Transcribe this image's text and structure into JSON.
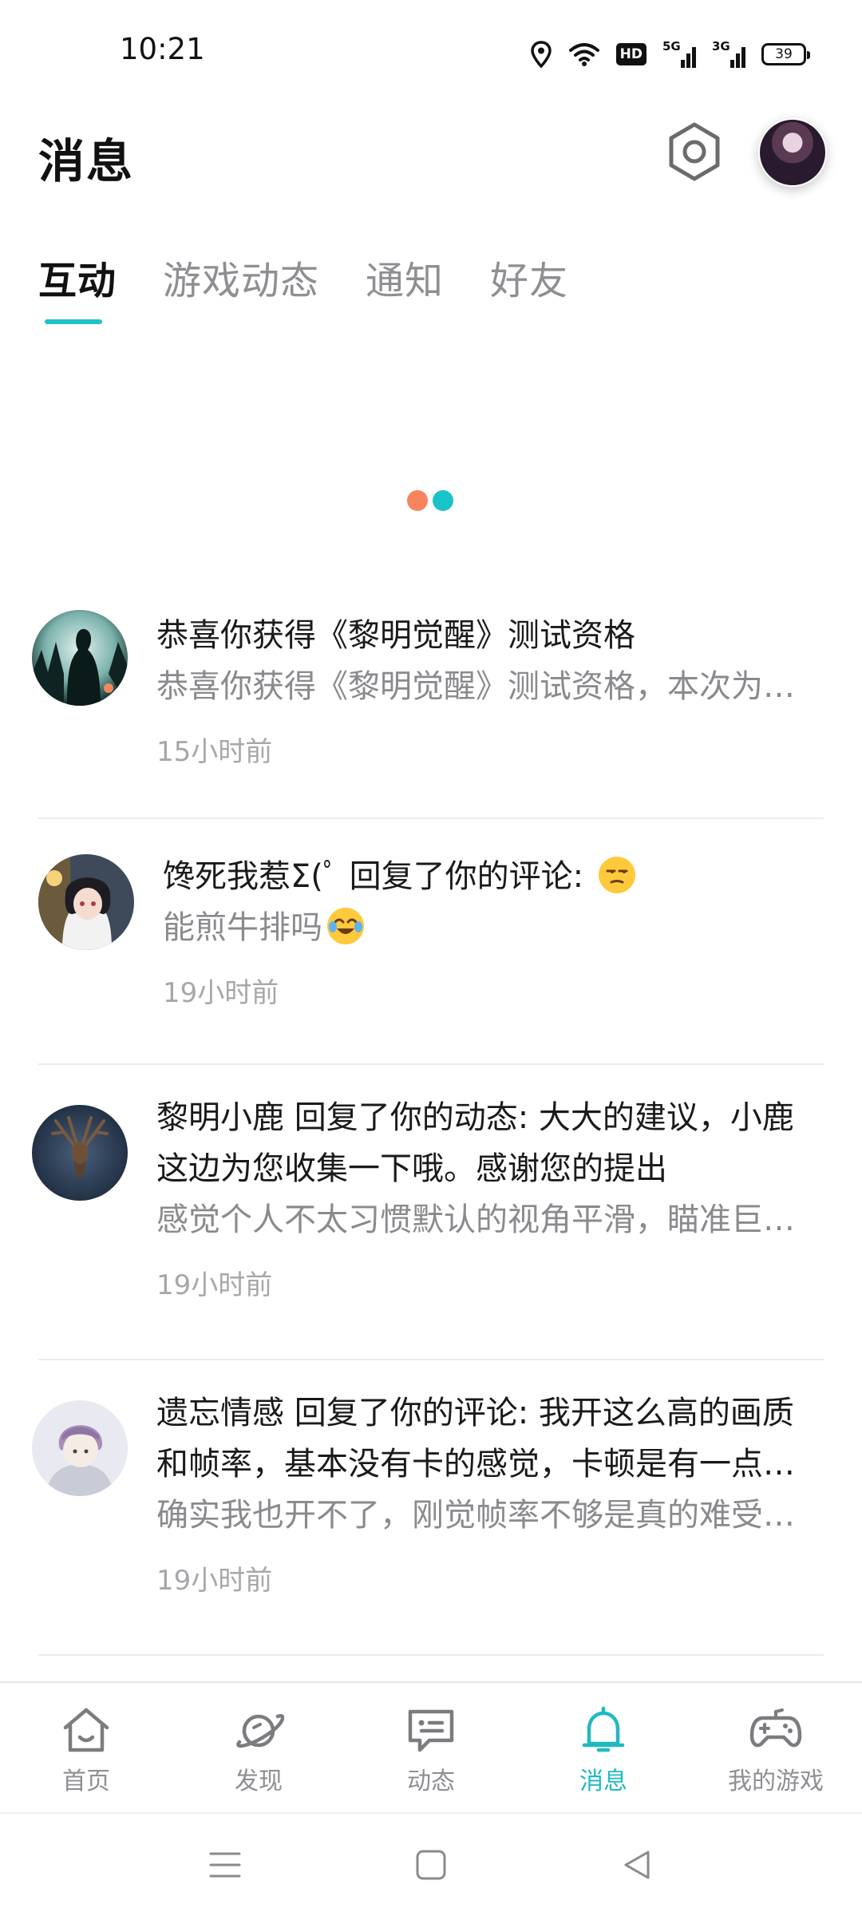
{
  "status_bar": {
    "time": "10:21",
    "hd_label": "HD",
    "net1": "5G",
    "net2": "3G",
    "battery": "39"
  },
  "header": {
    "title": "消息",
    "settings_icon": "hexagon-gear-icon"
  },
  "tabs": [
    {
      "label": "互动",
      "active": true
    },
    {
      "label": "游戏动态",
      "active": false
    },
    {
      "label": "通知",
      "active": false
    },
    {
      "label": "好友",
      "active": false
    }
  ],
  "colors": {
    "accent": "#20c1c8",
    "loading_orange": "#f7845e",
    "loading_teal": "#19c3c9"
  },
  "messages": [
    {
      "title": "恭喜你获得《黎明觉醒》测试资格",
      "sub": "恭喜你获得《黎明觉醒》测试资格，本次为…",
      "time": "15小时前"
    },
    {
      "title": "馋死我惹Σ(ﾟ 回复了你的评论: ",
      "sub": "能煎牛排吗",
      "time": "19小时前"
    },
    {
      "title": "黎明小鹿 回复了你的动态: 大大的建议，小鹿这边为您收集一下哦。感谢您的提出",
      "sub": "感觉个人不太习惯默认的视角平滑，瞄准巨…",
      "time": "19小时前"
    },
    {
      "title": "遗忘情感 回复了你的评论: 我开这么高的画质和帧率，基本没有卡的感觉，卡顿是有一点…",
      "sub": "确实我也开不了，刚觉帧率不够是真的难受…",
      "time": "19小时前"
    }
  ],
  "bottom_nav": [
    {
      "label": "首页",
      "icon": "home-icon",
      "active": false
    },
    {
      "label": "发现",
      "icon": "planet-icon",
      "active": false
    },
    {
      "label": "动态",
      "icon": "chat-icon",
      "active": false
    },
    {
      "label": "消息",
      "icon": "bell-icon",
      "active": true
    },
    {
      "label": "我的游戏",
      "icon": "gamepad-icon",
      "active": false
    }
  ]
}
